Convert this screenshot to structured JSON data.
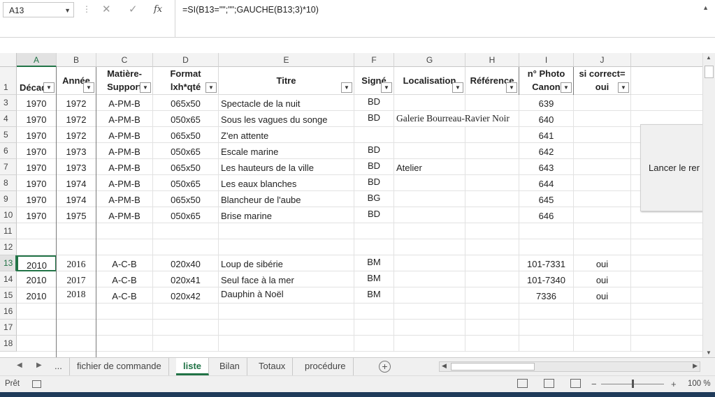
{
  "formula_bar": {
    "name_box": "A13",
    "formula": "=SI(B13=\"\";\"\";GAUCHE(B13;3)*10)",
    "fx_label": "fx"
  },
  "columns": [
    "A",
    "B",
    "C",
    "D",
    "E",
    "F",
    "G",
    "H",
    "I",
    "J"
  ],
  "header_row": {
    "row_number": "1",
    "cells": [
      {
        "line1": "Décad",
        "line2": ""
      },
      {
        "line1": "Année",
        "line2": ""
      },
      {
        "line1": "Matière-",
        "line2": "Support"
      },
      {
        "line1": "Format",
        "line2": "lxh*qté"
      },
      {
        "line1": "Titre",
        "line2": ""
      },
      {
        "line1": "Signé",
        "line2": ""
      },
      {
        "line1": "Localisation",
        "line2": ""
      },
      {
        "line1": "Référence",
        "line2": ""
      },
      {
        "line1": "n° Photo",
        "line2": "Canon"
      },
      {
        "line1": "si correct=",
        "line2": "oui"
      }
    ]
  },
  "rows": [
    {
      "n": "3",
      "cells": [
        "1970",
        "1972",
        "A-PM-B",
        "065x50",
        "Spectacle de la nuit",
        "BD",
        "",
        "",
        "639",
        ""
      ]
    },
    {
      "n": "4",
      "cells": [
        "1970",
        "1972",
        "A-PM-B",
        "050x65",
        "Sous les vagues du songe",
        "BD",
        "Galerie Bourreau-Ravier Noir",
        "",
        "640",
        ""
      ]
    },
    {
      "n": "5",
      "cells": [
        "1970",
        "1972",
        "A-PM-B",
        "065x50",
        "Z'en attente",
        "",
        "",
        "",
        "641",
        ""
      ]
    },
    {
      "n": "6",
      "cells": [
        "1970",
        "1973",
        "A-PM-B",
        "050x65",
        "Escale marine",
        "BD",
        "",
        "",
        "642",
        ""
      ]
    },
    {
      "n": "7",
      "cells": [
        "1970",
        "1973",
        "A-PM-B",
        "065x50",
        "Les hauteurs de la ville",
        "BD",
        "Atelier",
        "",
        "643",
        ""
      ]
    },
    {
      "n": "8",
      "cells": [
        "1970",
        "1974",
        "A-PM-B",
        "050x65",
        "Les eaux blanches",
        "BD",
        "",
        "",
        "644",
        ""
      ]
    },
    {
      "n": "9",
      "cells": [
        "1970",
        "1974",
        "A-PM-B",
        "065x50",
        "Blancheur de l'aube",
        "BG",
        "",
        "",
        "645",
        ""
      ]
    },
    {
      "n": "10",
      "cells": [
        "1970",
        "1975",
        "A-PM-B",
        "050x65",
        "Brise marine",
        "BD",
        "",
        "",
        "646",
        ""
      ]
    },
    {
      "n": "11",
      "cells": [
        "",
        "",
        "",
        "",
        "",
        "",
        "",
        "",
        "",
        ""
      ]
    },
    {
      "n": "12",
      "cells": [
        "",
        "",
        "",
        "",
        "",
        "",
        "",
        "",
        "",
        ""
      ]
    },
    {
      "n": "13",
      "cells": [
        "2010",
        "2016",
        "A-C-B",
        "020x40",
        "Loup de sibérie",
        "BM",
        "",
        "",
        "101-7331",
        "oui"
      ]
    },
    {
      "n": "14",
      "cells": [
        "2010",
        "2017",
        "A-C-B",
        "020x41",
        "Seul face à la mer",
        "BM",
        "",
        "",
        "101-7340",
        "oui"
      ]
    },
    {
      "n": "15",
      "cells": [
        "2010",
        "2018",
        "A-C-B",
        "020x42",
        "Dauphin à Noël",
        "BM",
        "",
        "",
        "7336",
        "oui"
      ]
    },
    {
      "n": "16",
      "cells": [
        "",
        "",
        "",
        "",
        "",
        "",
        "",
        "",
        "",
        ""
      ]
    },
    {
      "n": "17",
      "cells": [
        "",
        "",
        "",
        "",
        "",
        "",
        "",
        "",
        "",
        ""
      ]
    },
    {
      "n": "18",
      "cells": [
        "",
        "",
        "",
        "",
        "",
        "",
        "",
        "",
        "",
        ""
      ]
    }
  ],
  "macro_button": {
    "label": "Lancer le rer"
  },
  "sheet_tabs": {
    "ellipsis": "...",
    "tabs": [
      "fichier de commande",
      "liste",
      "Bilan",
      "Totaux",
      "procédure"
    ],
    "active": "liste",
    "add": "+"
  },
  "status_bar": {
    "ready": "Prêt",
    "zoom": "100 %",
    "zoom_minus": "−",
    "zoom_plus": "+"
  }
}
